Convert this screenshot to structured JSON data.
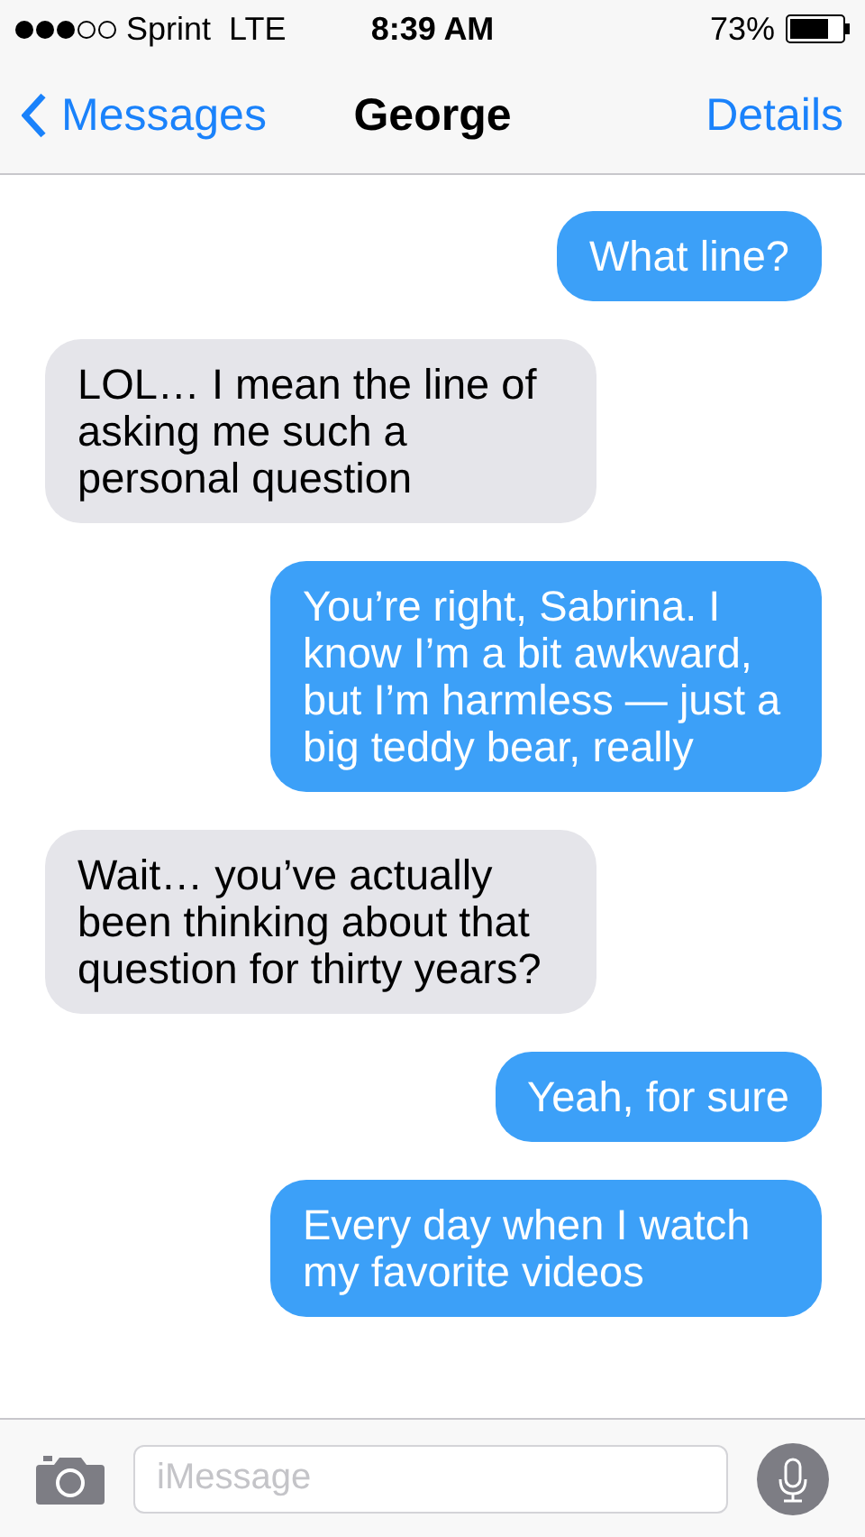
{
  "status_bar": {
    "carrier": "Sprint",
    "network": "LTE",
    "time": "8:39 AM",
    "battery": "73%"
  },
  "nav": {
    "back": "Messages",
    "title": "George",
    "action": "Details"
  },
  "messages": [
    {
      "kind": "sent",
      "text": "What line?"
    },
    {
      "kind": "received",
      "text": "LOL… I mean the line of asking me such a personal question"
    },
    {
      "kind": "sent",
      "text": "You’re right, Sabrina. I know I’m a bit awkward, but I’m harmless — just a big teddy bear, really"
    },
    {
      "kind": "received",
      "text": "Wait… you’ve actually been thinking about that question for thirty years?"
    },
    {
      "kind": "sent",
      "text": "Yeah, for sure"
    },
    {
      "kind": "sent",
      "text": "Every day when I watch my favorite videos"
    }
  ],
  "composer": {
    "placeholder": "iMessage"
  }
}
